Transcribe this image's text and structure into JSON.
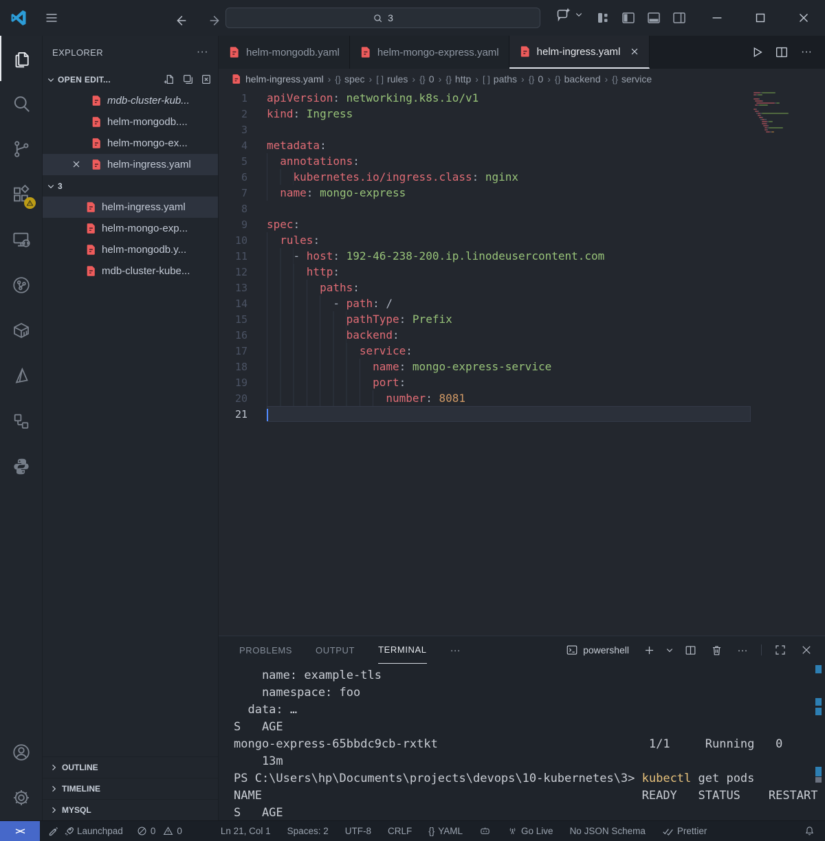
{
  "titlebar": {
    "search_value": "3"
  },
  "sidebar": {
    "title": "EXPLORER",
    "open_editors_label": "OPEN EDIT...",
    "open_editors": [
      {
        "label": "mdb-cluster-kub...",
        "preview": true
      },
      {
        "label": "helm-mongodb...."
      },
      {
        "label": "helm-mongo-ex..."
      },
      {
        "label": "helm-ingress.yaml",
        "selected": true,
        "close": true
      }
    ],
    "folder_label": "3",
    "files": [
      {
        "label": "helm-ingress.yaml",
        "selected": true
      },
      {
        "label": "helm-mongo-exp..."
      },
      {
        "label": "helm-mongodb.y..."
      },
      {
        "label": "mdb-cluster-kube..."
      }
    ],
    "bottom_sections": [
      "OUTLINE",
      "TIMELINE",
      "MYSQL"
    ]
  },
  "tabs": [
    {
      "label": "helm-mongodb.yaml"
    },
    {
      "label": "helm-mongo-express.yaml"
    },
    {
      "label": "helm-ingress.yaml",
      "active": true
    }
  ],
  "breadcrumbs": [
    {
      "file": true,
      "label": "helm-ingress.yaml"
    },
    {
      "sym": "{}",
      "label": "spec"
    },
    {
      "sym": "[ ]",
      "label": "rules"
    },
    {
      "sym": "{}",
      "label": "0"
    },
    {
      "sym": "{}",
      "label": "http"
    },
    {
      "sym": "[ ]",
      "label": "paths"
    },
    {
      "sym": "{}",
      "label": "0"
    },
    {
      "sym": "{}",
      "label": "backend"
    },
    {
      "sym": "{}",
      "label": "service"
    }
  ],
  "code": {
    "cursor_line": 21,
    "lines": [
      {
        "n": 1,
        "indent": 0,
        "tokens": [
          {
            "t": "k",
            "s": "apiVersion"
          },
          {
            "t": "p",
            "s": ": "
          },
          {
            "t": "v",
            "s": "networking.k8s.io/v1"
          }
        ]
      },
      {
        "n": 2,
        "indent": 0,
        "tokens": [
          {
            "t": "k",
            "s": "kind"
          },
          {
            "t": "p",
            "s": ": "
          },
          {
            "t": "v",
            "s": "Ingress"
          }
        ]
      },
      {
        "n": 3,
        "indent": 0,
        "tokens": []
      },
      {
        "n": 4,
        "indent": 0,
        "tokens": [
          {
            "t": "k",
            "s": "metadata"
          },
          {
            "t": "p",
            "s": ":"
          }
        ]
      },
      {
        "n": 5,
        "indent": 2,
        "tokens": [
          {
            "t": "k",
            "s": "annotations"
          },
          {
            "t": "p",
            "s": ":"
          }
        ]
      },
      {
        "n": 6,
        "indent": 4,
        "tokens": [
          {
            "t": "k",
            "s": "kubernetes.io/ingress.class"
          },
          {
            "t": "p",
            "s": ": "
          },
          {
            "t": "v",
            "s": "nginx"
          }
        ]
      },
      {
        "n": 7,
        "indent": 2,
        "tokens": [
          {
            "t": "k",
            "s": "name"
          },
          {
            "t": "p",
            "s": ": "
          },
          {
            "t": "v",
            "s": "mongo-express"
          }
        ]
      },
      {
        "n": 8,
        "indent": 0,
        "tokens": []
      },
      {
        "n": 9,
        "indent": 0,
        "tokens": [
          {
            "t": "k",
            "s": "spec"
          },
          {
            "t": "p",
            "s": ":"
          }
        ]
      },
      {
        "n": 10,
        "indent": 2,
        "tokens": [
          {
            "t": "k",
            "s": "rules"
          },
          {
            "t": "p",
            "s": ":"
          }
        ]
      },
      {
        "n": 11,
        "indent": 4,
        "tokens": [
          {
            "t": "p",
            "s": "- "
          },
          {
            "t": "k",
            "s": "host"
          },
          {
            "t": "p",
            "s": ": "
          },
          {
            "t": "v",
            "s": "192-46-238-200.ip.linodeusercontent.com"
          }
        ]
      },
      {
        "n": 12,
        "indent": 6,
        "tokens": [
          {
            "t": "k",
            "s": "http"
          },
          {
            "t": "p",
            "s": ":"
          }
        ]
      },
      {
        "n": 13,
        "indent": 8,
        "tokens": [
          {
            "t": "k",
            "s": "paths"
          },
          {
            "t": "p",
            "s": ":"
          }
        ]
      },
      {
        "n": 14,
        "indent": 10,
        "tokens": [
          {
            "t": "p",
            "s": "- "
          },
          {
            "t": "k",
            "s": "path"
          },
          {
            "t": "p",
            "s": ": "
          },
          {
            "t": "p",
            "s": "/"
          }
        ]
      },
      {
        "n": 15,
        "indent": 12,
        "tokens": [
          {
            "t": "k",
            "s": "pathType"
          },
          {
            "t": "p",
            "s": ": "
          },
          {
            "t": "v",
            "s": "Prefix"
          }
        ]
      },
      {
        "n": 16,
        "indent": 12,
        "tokens": [
          {
            "t": "k",
            "s": "backend"
          },
          {
            "t": "p",
            "s": ":"
          }
        ]
      },
      {
        "n": 17,
        "indent": 14,
        "tokens": [
          {
            "t": "k",
            "s": "service"
          },
          {
            "t": "p",
            "s": ":"
          }
        ]
      },
      {
        "n": 18,
        "indent": 16,
        "tokens": [
          {
            "t": "k",
            "s": "name"
          },
          {
            "t": "p",
            "s": ": "
          },
          {
            "t": "v",
            "s": "mongo-express-service"
          }
        ]
      },
      {
        "n": 19,
        "indent": 16,
        "tokens": [
          {
            "t": "k",
            "s": "port"
          },
          {
            "t": "p",
            "s": ":"
          }
        ]
      },
      {
        "n": 20,
        "indent": 18,
        "tokens": [
          {
            "t": "k",
            "s": "number"
          },
          {
            "t": "p",
            "s": ": "
          },
          {
            "t": "n",
            "s": "8081"
          }
        ]
      },
      {
        "n": 21,
        "indent": 0,
        "tokens": []
      }
    ]
  },
  "panel": {
    "tabs": [
      "PROBLEMS",
      "OUTPUT",
      "TERMINAL"
    ],
    "active_tab": "TERMINAL",
    "shell_label": "powershell",
    "terminal_lines": [
      {
        "segments": [
          {
            "text": "    name: example-tls"
          }
        ]
      },
      {
        "segments": [
          {
            "text": "    namespace: foo"
          }
        ]
      },
      {
        "segments": [
          {
            "text": "  data: …"
          }
        ]
      },
      {
        "segments": [
          {
            "text": "S   AGE"
          }
        ]
      },
      {
        "segments": [
          {
            "text": "mongo-express-65bbdc9cb-rxtkt                              1/1     Running   0"
          }
        ]
      },
      {
        "segments": [
          {
            "text": "    13m"
          }
        ]
      },
      {
        "segments": [
          {
            "text": "PS C:\\Users\\hp\\Documents\\projects\\devops\\10-kubernetes\\3> "
          },
          {
            "text": "kubectl",
            "color": "#e5c07b"
          },
          {
            "text": " get pods"
          }
        ]
      },
      {
        "segments": [
          {
            "text": "NAME                                                      READY   STATUS    RESTART"
          }
        ]
      },
      {
        "segments": [
          {
            "text": "S   AGE"
          }
        ]
      }
    ]
  },
  "statusbar": {
    "remote_label": "><",
    "launchpad_label": "Launchpad",
    "errors": "0",
    "warnings": "0",
    "line_col": "Ln 21, Col 1",
    "spaces": "Spaces: 2",
    "encoding": "UTF-8",
    "eol": "CRLF",
    "language_symbol": "{}",
    "language": "YAML",
    "go_live": "Go Live",
    "json_schema": "No JSON Schema",
    "prettier": "Prettier"
  },
  "colors": {
    "accent_remote_blue": "#4668c9",
    "yaml_key_red": "#e06c75",
    "yaml_value_green": "#98c379",
    "yaml_number_orange": "#d19a66",
    "file_icon_red": "#ee5c5c",
    "warning_badge_yellow": "#d8b112",
    "terminal_command_yellow": "#e5c07b",
    "cursor_blue": "#528bff"
  }
}
